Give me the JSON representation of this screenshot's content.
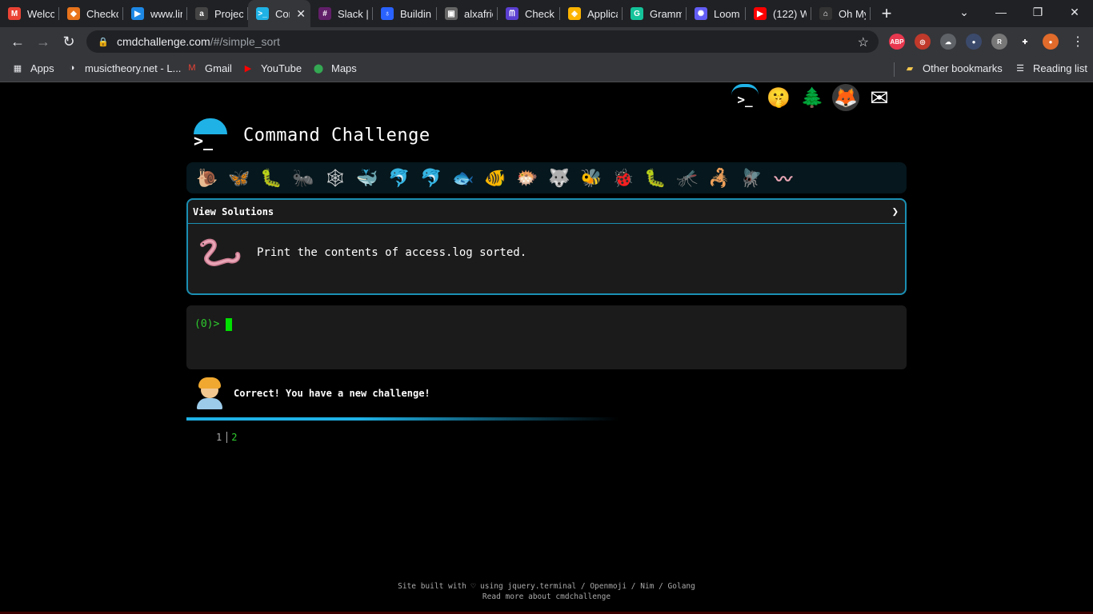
{
  "tabs": [
    {
      "title": "Welcom",
      "icon": "gmail-icon",
      "color": "#ea4335",
      "glyph": "M"
    },
    {
      "title": "Checko",
      "icon": "checkout-icon",
      "color": "#e8741c",
      "glyph": "◆"
    },
    {
      "title": "www.lin",
      "icon": "video-icon",
      "color": "#1e88e5",
      "glyph": "▶"
    },
    {
      "title": "Project",
      "icon": "project-icon",
      "color": "#444",
      "glyph": "a"
    },
    {
      "title": "Con",
      "icon": "terminal-icon",
      "color": "#1fb2e6",
      "glyph": ">_",
      "active": true
    },
    {
      "title": "Slack |",
      "icon": "slack-icon",
      "color": "#611f69",
      "glyph": "#"
    },
    {
      "title": "Buildin",
      "icon": "building-icon",
      "color": "#2962ff",
      "glyph": "♁"
    },
    {
      "title": "alxafric",
      "icon": "alx-icon",
      "color": "#666",
      "glyph": "▣"
    },
    {
      "title": "Check i",
      "icon": "check-icon",
      "color": "#5b3fd1",
      "glyph": "ᗰ"
    },
    {
      "title": "Applica",
      "icon": "airtable-icon",
      "color": "#fcb400",
      "glyph": "◈"
    },
    {
      "title": "Gramm",
      "icon": "grammarly-icon",
      "color": "#15c39a",
      "glyph": "G"
    },
    {
      "title": "Loom |",
      "icon": "loom-icon",
      "color": "#625df5",
      "glyph": "✺"
    },
    {
      "title": "(122) W",
      "icon": "youtube-icon",
      "color": "#ff0000",
      "glyph": "▶"
    },
    {
      "title": "Oh My",
      "icon": "ohmy-icon",
      "color": "#333",
      "glyph": "⌂"
    }
  ],
  "address": {
    "domain": "cmdchallenge.com",
    "path": "/#/simple_sort"
  },
  "bookmarks": [
    {
      "label": "Apps",
      "icon": "apps-grid-icon"
    },
    {
      "label": "musictheory.net - L...",
      "icon": "musictheory-icon"
    },
    {
      "label": "Gmail",
      "icon": "gmail-icon"
    },
    {
      "label": "YouTube",
      "icon": "youtube-icon"
    },
    {
      "label": "Maps",
      "icon": "maps-icon"
    }
  ],
  "bookmarks_right": {
    "other": "Other bookmarks",
    "reading": "Reading list"
  },
  "extensions": [
    {
      "name": "adblock-icon",
      "label": "ABP",
      "color": "#e8384f"
    },
    {
      "name": "cast-icon",
      "label": "◎",
      "color": "#c0392b"
    },
    {
      "name": "cloud-icon",
      "label": "☁",
      "color": "#5f6368"
    },
    {
      "name": "spy-icon",
      "label": "●",
      "color": "#3b4a6b"
    },
    {
      "name": "r-icon",
      "label": "R",
      "color": "#777"
    },
    {
      "name": "puzzle-icon",
      "label": "✚",
      "color": "#35363a"
    },
    {
      "name": "profile-avatar",
      "label": "●",
      "color": "#e06b2b"
    }
  ],
  "site": {
    "title": "Command Challenge",
    "view_solutions": "View Solutions",
    "task": "Print the contents of access.log sorted.",
    "prompt": "(0)>",
    "feedback": "Correct! You have a new challenge!",
    "output_line_no": "1",
    "output_value": "2",
    "footer_line1": "Site built with ♡ using jquery.terminal / Openmoji / Nim / Golang",
    "footer_line2": "Read more about cmdchallenge"
  },
  "top_icons": [
    {
      "name": "terminal-logo-icon",
      "glyph": ">_"
    },
    {
      "name": "shushing-face-icon",
      "glyph": "🤫"
    },
    {
      "name": "evergreen-tree-icon",
      "glyph": "🌲"
    },
    {
      "name": "gitlab-icon",
      "glyph": "🦊"
    },
    {
      "name": "envelope-icon",
      "glyph": "✉"
    }
  ],
  "animals": [
    {
      "name": "snail-icon",
      "glyph": "🐌"
    },
    {
      "name": "butterfly-icon",
      "glyph": "🦋"
    },
    {
      "name": "caterpillar-icon",
      "glyph": "🐛"
    },
    {
      "name": "ant-icon",
      "glyph": "🐜"
    },
    {
      "name": "web-icon",
      "glyph": "🕸"
    },
    {
      "name": "whale-icon",
      "glyph": "🐳"
    },
    {
      "name": "dolphin-icon",
      "glyph": "🐬"
    },
    {
      "name": "dolphin-alt-icon",
      "glyph": "🐬"
    },
    {
      "name": "fish-icon",
      "glyph": "🐟"
    },
    {
      "name": "tropical-fish-icon",
      "glyph": "🐠"
    },
    {
      "name": "blowfish-icon",
      "glyph": "🐡"
    },
    {
      "name": "wolf-icon",
      "glyph": "🐺"
    },
    {
      "name": "bee-icon",
      "glyph": "🐝"
    },
    {
      "name": "ladybug-icon",
      "glyph": "🐞"
    },
    {
      "name": "worm-green-icon",
      "glyph": "🐛"
    },
    {
      "name": "mosquito-icon",
      "glyph": "🦟"
    },
    {
      "name": "scorpion-icon",
      "glyph": "🦂"
    },
    {
      "name": "fly-icon",
      "glyph": "🪰"
    },
    {
      "name": "worm-pink-icon",
      "glyph": "〰"
    }
  ],
  "colors": {
    "accent": "#1fb2e6",
    "prompt_green": "#2ecc2e",
    "panel_bg": "#1b1b1b"
  }
}
